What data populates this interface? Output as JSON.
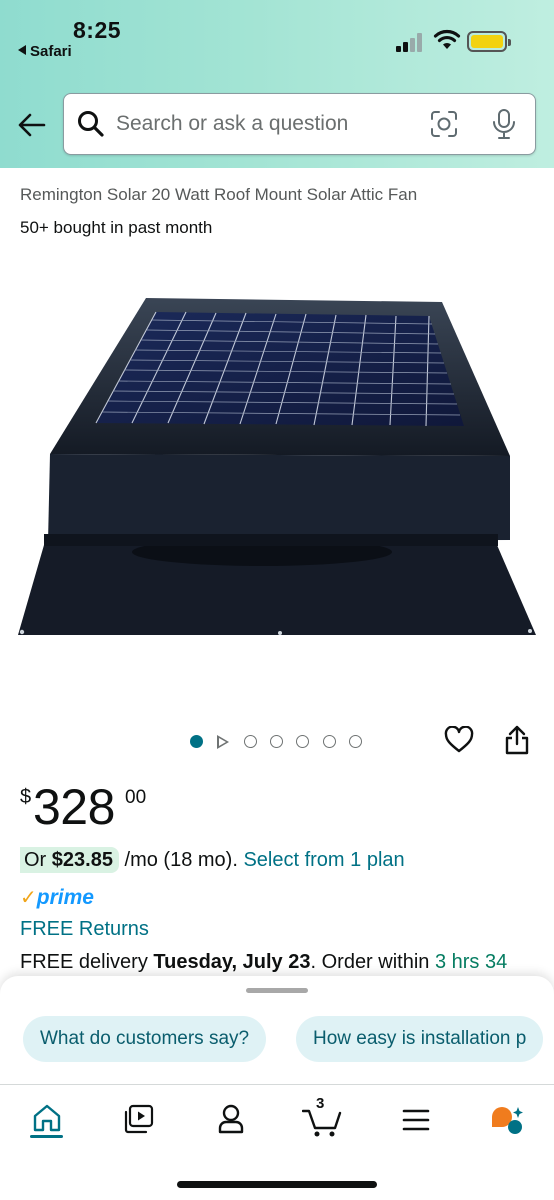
{
  "status_bar": {
    "time": "8:25",
    "back_app": "Safari"
  },
  "search": {
    "placeholder": "Search or ask a question"
  },
  "product": {
    "title": "Remington Solar 20 Watt Roof Mount Solar Attic Fan",
    "social_proof": "50+ bought in past month",
    "image_count": 7,
    "active_image_index": 0
  },
  "price": {
    "symbol": "$",
    "whole": "328",
    "fraction": "00"
  },
  "financing": {
    "prefix": "Or ",
    "amount": "$23.85",
    "term": " /mo (18 mo). ",
    "link": "Select from 1 plan"
  },
  "prime": {
    "check": "✓",
    "label": "prime"
  },
  "returns": "FREE Returns",
  "delivery": {
    "prefix": "FREE delivery ",
    "date": "Tuesday, July 23",
    "middle": ". Order within ",
    "countdown": "3 hrs 34"
  },
  "questions": [
    "What do customers say?",
    "How easy is installation p"
  ],
  "tabs": [
    {
      "name": "home",
      "icon": "home-icon",
      "active": true
    },
    {
      "name": "videos",
      "icon": "video-icon"
    },
    {
      "name": "account",
      "icon": "person-icon"
    },
    {
      "name": "cart",
      "icon": "cart-icon",
      "count": "3"
    },
    {
      "name": "menu",
      "icon": "menu-icon"
    },
    {
      "name": "rufus",
      "icon": "ai-assistant-icon"
    }
  ],
  "colors": {
    "link": "#007185",
    "accent_green": "#067d62",
    "prime_blue": "#1399ff",
    "prime_check": "#f0a519"
  }
}
